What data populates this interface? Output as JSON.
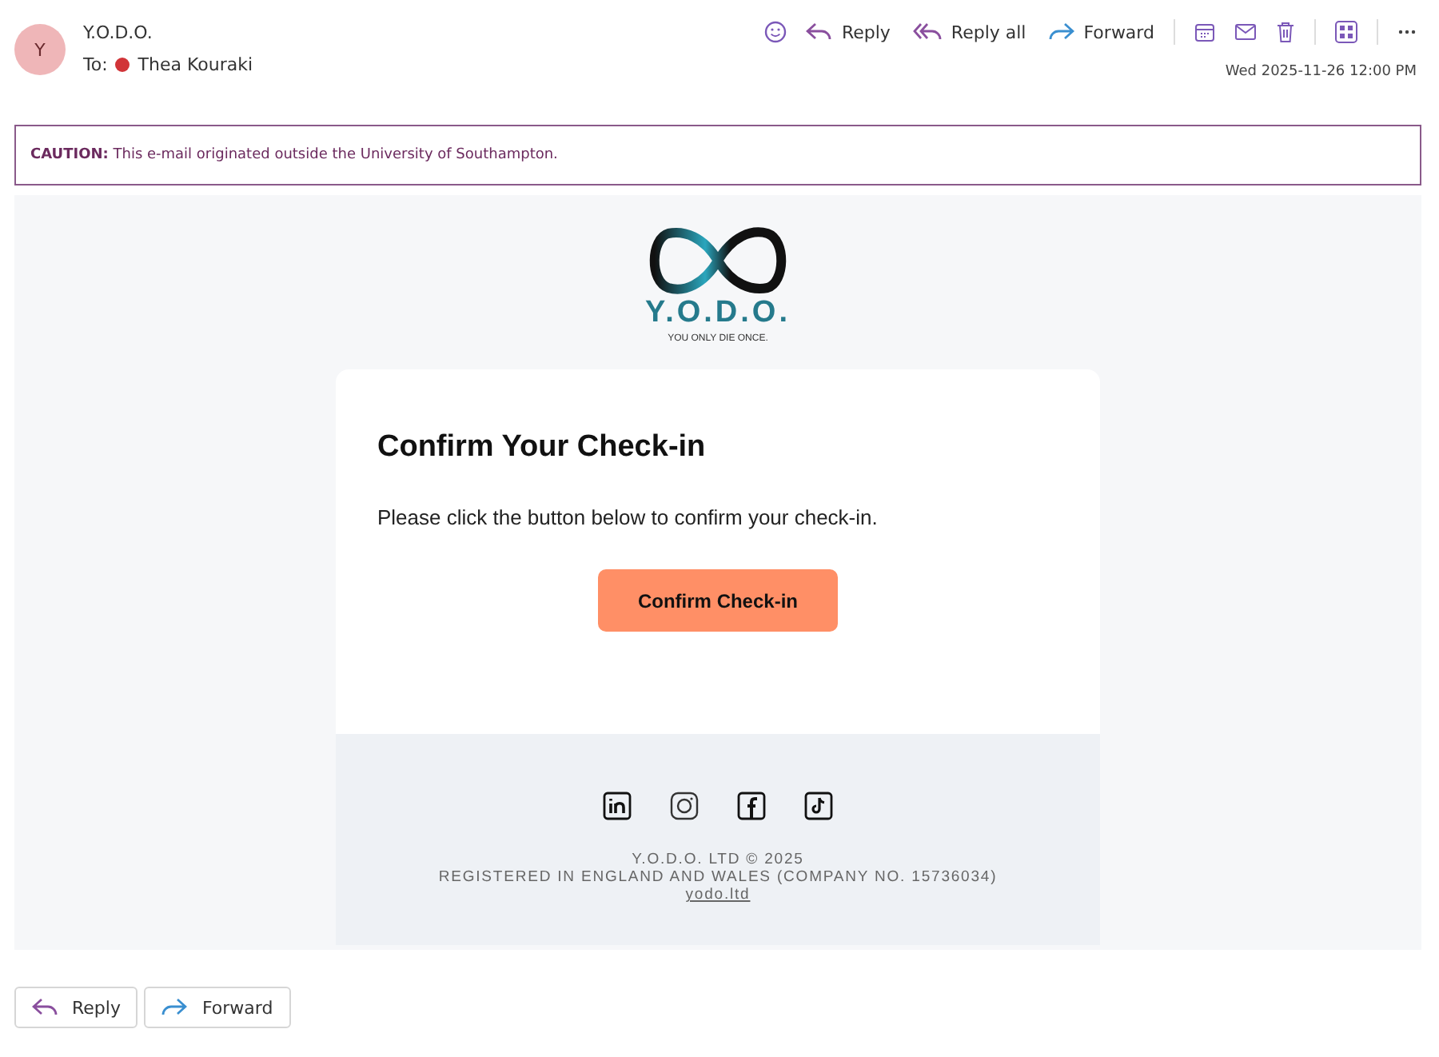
{
  "sender": {
    "avatar": "Y",
    "name": "Y.O.D.O.",
    "to_label": "To:",
    "recipient": "Thea Kouraki"
  },
  "toolbar": {
    "actions": [
      {
        "label": "Reply",
        "kind": "reply"
      },
      {
        "label": "Reply all",
        "kind": "reply_all"
      },
      {
        "label": "Forward",
        "kind": "forward"
      }
    ],
    "date": "Wed 2025-11-26 12:00 PM"
  },
  "caution": {
    "text": "**CAUTION:** This e-mail originated outside the University of Southampton."
  },
  "email": {
    "logo_text": "Y.O.D.O.",
    "tagline": "YOU ONLY DIE ONCE.",
    "heading": "Confirm Your Check-in",
    "message": "Please click the button below to confirm your check-in.",
    "button": "Confirm Check-in",
    "footer": {
      "copyright": "Y.O.D.O. LTD © 2025",
      "registration": "REGISTERED IN ENGLAND AND WALES (COMPANY NO. 15736034)",
      "link": "yodo.ltd"
    }
  },
  "bottom_actions": [
    {
      "label": "Reply",
      "kind": "reply"
    },
    {
      "label": "Forward",
      "kind": "forward"
    }
  ]
}
